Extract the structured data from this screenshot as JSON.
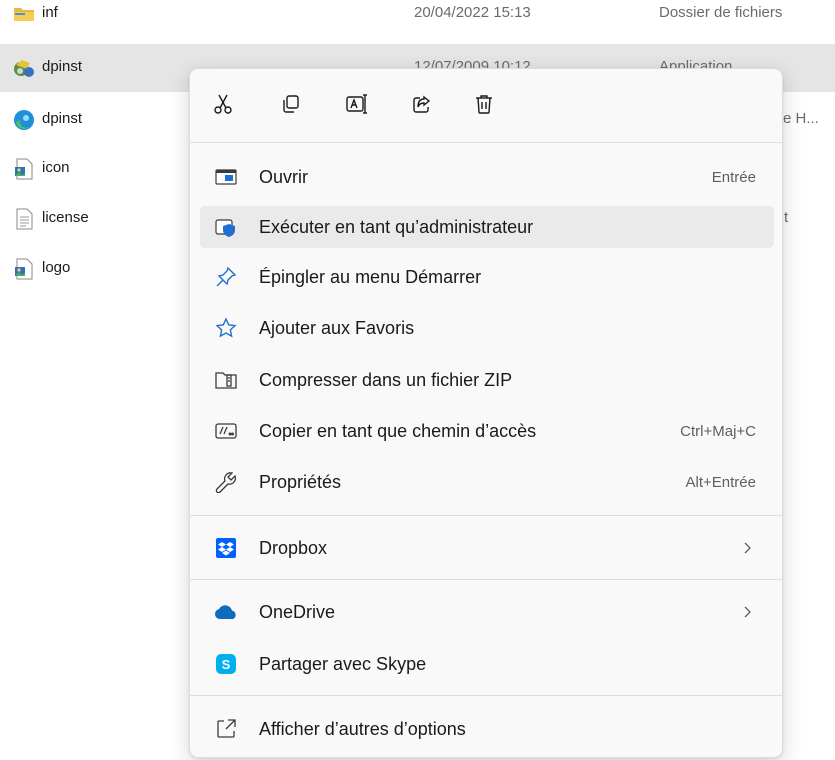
{
  "files": [
    {
      "name": "inf",
      "date": "20/04/2022 15:13",
      "type": "Dossier de fichiers",
      "icon": "folder-icon"
    },
    {
      "name": "dpinst",
      "date": "12/07/2009 10:12",
      "type": "Application",
      "icon": "app-icon",
      "selected": true
    },
    {
      "name": "dpinst",
      "type_partial": "e H...",
      "icon": "edge-document-icon"
    },
    {
      "name": "icon",
      "icon": "image-file-icon"
    },
    {
      "name": "license",
      "type_partial": "t",
      "icon": "text-file-icon"
    },
    {
      "name": "logo",
      "icon": "image-file-icon"
    }
  ],
  "context_menu": {
    "toolbar": [
      {
        "action": "Couper",
        "icon": "cut-icon"
      },
      {
        "action": "Copier",
        "icon": "copy-icon"
      },
      {
        "action": "Renommer",
        "icon": "rename-icon"
      },
      {
        "action": "Partager",
        "icon": "share-icon"
      },
      {
        "action": "Supprimer",
        "icon": "delete-icon"
      }
    ],
    "items": [
      {
        "label": "Ouvrir",
        "shortcut": "Entrée",
        "icon": "open-window-icon"
      },
      {
        "label": "Exécuter en tant qu’administrateur",
        "shortcut": "",
        "icon": "shield-icon",
        "hovered": true
      },
      {
        "label": "Épingler au menu Démarrer",
        "shortcut": "",
        "icon": "pin-icon"
      },
      {
        "label": "Ajouter aux Favoris",
        "shortcut": "",
        "icon": "star-icon"
      },
      {
        "label": "Compresser dans un fichier ZIP",
        "shortcut": "",
        "icon": "zip-folder-icon"
      },
      {
        "label": "Copier en tant que chemin d’accès",
        "shortcut": "Ctrl+Maj+C",
        "icon": "path-icon"
      },
      {
        "label": "Propriétés",
        "shortcut": "Alt+Entrée",
        "icon": "wrench-icon"
      },
      {
        "label": "Dropbox",
        "submenu": true,
        "icon": "dropbox-icon"
      },
      {
        "label": "OneDrive",
        "submenu": true,
        "icon": "onedrive-icon"
      },
      {
        "label": "Partager avec Skype",
        "icon": "skype-icon"
      },
      {
        "label": "Afficher d’autres d’options",
        "icon": "more-options-icon"
      }
    ]
  },
  "colors": {
    "selected_row": "#e5e5e5",
    "menu_background": "#f9f9f9",
    "hover": "#eaeaea",
    "accent_blue": "#0067c0",
    "dropbox_blue": "#0061fe",
    "onedrive_blue": "#0f6cbd",
    "skype_blue": "#00aff0"
  }
}
